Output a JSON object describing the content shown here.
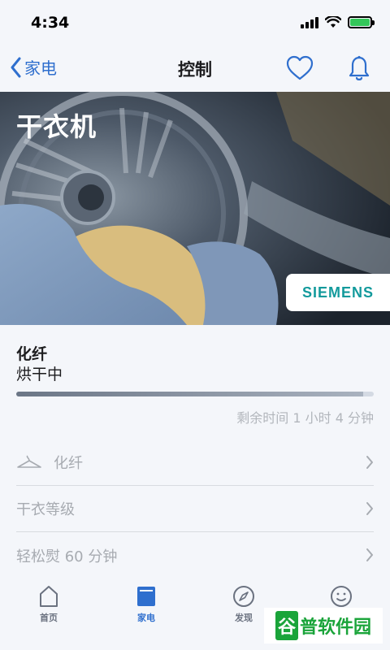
{
  "status_bar": {
    "time": "4:34"
  },
  "nav": {
    "back_label": "家电",
    "title": "控制"
  },
  "hero": {
    "title": "干衣机",
    "brand": "SIEMENS"
  },
  "program": {
    "name": "化纤",
    "status": "烘干中",
    "progress": 0.97,
    "remaining": "剩余时间 1 小时 4 分钟"
  },
  "settings": [
    {
      "label": "化纤",
      "icon": "hanger-icon"
    },
    {
      "label": "干衣等级"
    },
    {
      "label": "轻松熨 60 分钟"
    }
  ],
  "tabs": [
    {
      "label": "首页",
      "icon": "home-icon"
    },
    {
      "label": "家电",
      "icon": "appliance-icon",
      "active": true
    },
    {
      "label": "发现",
      "icon": "compass-icon"
    },
    {
      "label": "",
      "icon": "smiley-icon"
    }
  ],
  "watermark": {
    "first": "谷",
    "rest": "普软件园"
  },
  "colors": {
    "accent": "#2f6fce",
    "brand": "#139a9c",
    "background": "#f4f6fa"
  }
}
